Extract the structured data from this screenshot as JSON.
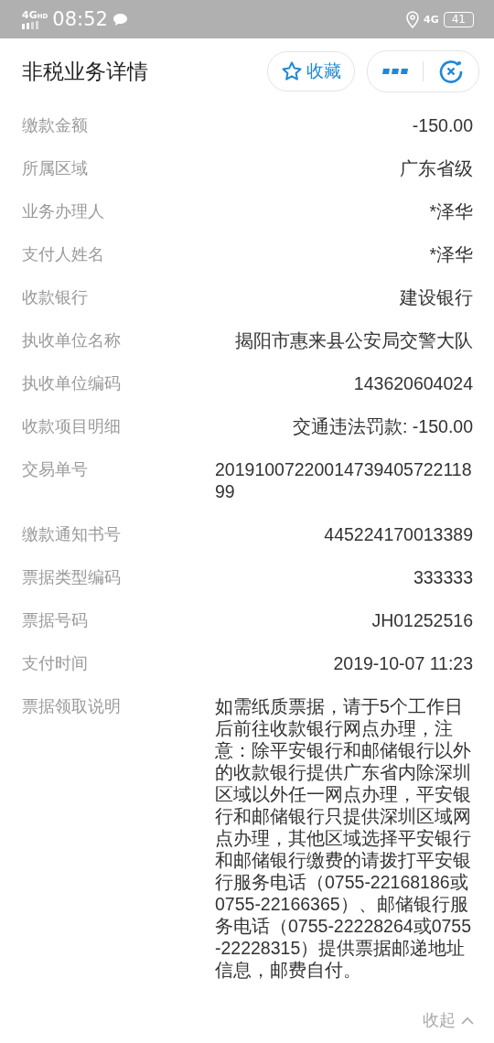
{
  "status_bar": {
    "network": "4G",
    "network_sup": "HD",
    "time": "08:52",
    "network_right": "4G",
    "battery": "41"
  },
  "header": {
    "title": "非税业务详情",
    "favorite_button": "收藏"
  },
  "fields": [
    {
      "label": "缴款金额",
      "value": "-150.00"
    },
    {
      "label": "所属区域",
      "value": "广东省级"
    },
    {
      "label": "业务办理人",
      "value": "*泽华"
    },
    {
      "label": "支付人姓名",
      "value": "*泽华"
    },
    {
      "label": "收款银行",
      "value": "建设银行"
    },
    {
      "label": "执收单位名称",
      "value": "揭阳市惠来县公安局交警大队"
    },
    {
      "label": "执收单位编码",
      "value": "143620604024"
    },
    {
      "label": "收款项目明细",
      "value": "交通违法罚款: -150.00"
    },
    {
      "label": "交易单号",
      "value": "2019100722001473940572211899"
    },
    {
      "label": "缴款通知书号",
      "value": "445224170013389"
    },
    {
      "label": "票据类型编码",
      "value": "333333"
    },
    {
      "label": "票据号码",
      "value": "JH01252516"
    },
    {
      "label": "支付时间",
      "value": "2019-10-07 11:23"
    },
    {
      "label": "票据领取说明",
      "value": "如需纸质票据，请于5个工作日后前往收款银行网点办理，注意：除平安银行和邮储银行以外的收款银行提供广东省内除深圳区域以外任一网点办理，平安银行和邮储银行只提供深圳区域网点办理，其他区域选择平安银行和邮储银行缴费的请拨打平安银行服务电话（0755-22168186或0755-22166365）、邮储银行服务电话（0755-22228264或0755-22228315）提供票据邮递地址信息，邮费自付。"
    }
  ],
  "collapse_link": "收起"
}
